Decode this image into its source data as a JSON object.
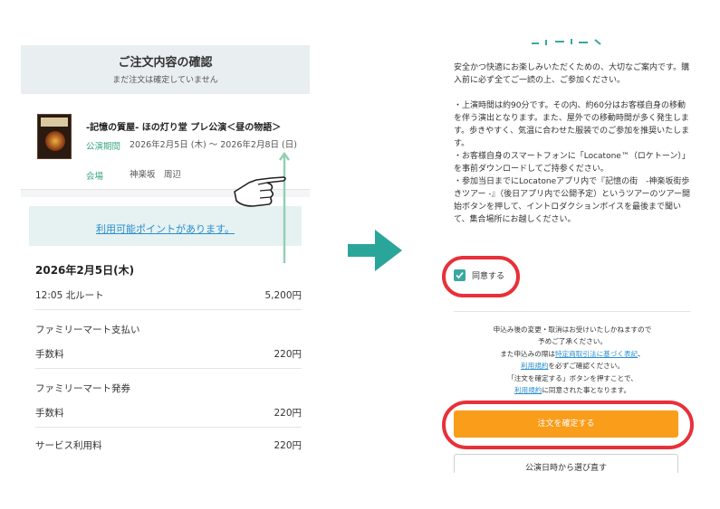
{
  "left": {
    "header": {
      "title": "ご注文内容の確認",
      "subtitle": "まだ注文は確定していません"
    },
    "event": {
      "title": "-記憶の質屋- ほの灯り堂 プレ公演＜昼の物語＞",
      "period_label": "公演期間",
      "period_value": "2026年2月5日 (木) 〜 2026年2月8日 (日)",
      "venue_label": "会場",
      "venue_value": "神楽坂　周辺"
    },
    "points_link": "利用可能ポイントがあります。",
    "date_heading": "2026年2月5日(木)",
    "ticket": {
      "label": "12:05 北ルート",
      "price": "5,200円"
    },
    "payment": {
      "title": "ファミリーマート支払い",
      "fee_label": "手数料",
      "fee_value": "220円"
    },
    "issue": {
      "title": "ファミリーマート発券",
      "fee_label": "手数料",
      "fee_value": "220円"
    },
    "service": {
      "label": "サービス利用料",
      "value": "220円"
    }
  },
  "right": {
    "intro": "安全かつ快適にお楽しみいただくための、大切なご案内です。購入前に必ず全てご一読の上、ご参加ください。",
    "bullets": "・上演時間は約90分です。その内、約60分はお客様自身の移動を伴う演出となります。また、屋外での移動時間が多く発生します。歩きやすく、気温に合わせた服装でのご参加を推奨いたします。\n・お客様自身のスマートフォンに「Locatone™（ロケトーン）」を事前ダウンロードしてご持参ください。\n・参加当日までにLocatoneアプリ内で『記憶の街　-神楽坂街歩きツアー -』（後日アプリ内で公開予定）というツアーのツアー開始ボタンを押して、イントロダクションボイスを最後まで聞いて、集合場所にお越しください。",
    "agree_label": "同意する",
    "terms": {
      "line1": "申込み後の変更・取消はお受けいたしかねますので",
      "line2": "予めご了承ください。",
      "line3_pre": "また申込みの際は",
      "line3_link": "特定商取引法に基づく表記",
      "line3_post": "、",
      "line4_link": "利用規約",
      "line4_post": "を必ずご確認ください。",
      "line5": "「注文を確定する」ボタンを押すことで、",
      "line6_link": "利用規約",
      "line6_post": "に同意された事となります。"
    },
    "confirm_button": "注文を確定する",
    "reselect_button": "公演日時から選び直す"
  },
  "colors": {
    "accent_green": "#3aa87f",
    "teal_arrow": "#2aa59a",
    "orange_button": "#f99d1b",
    "highlight_red": "#e8303a",
    "link_blue": "#2a8fd0"
  }
}
